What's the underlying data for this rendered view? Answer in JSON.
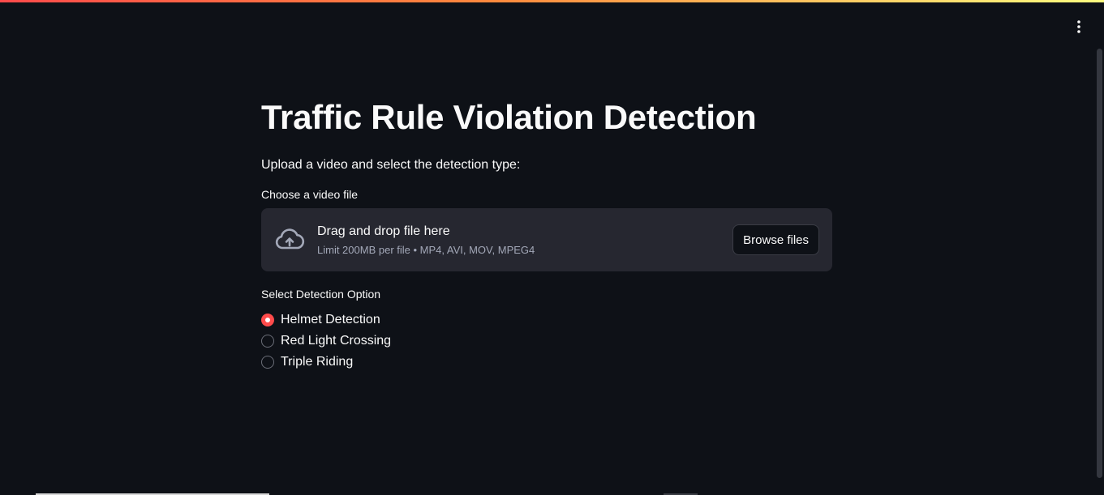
{
  "app": {
    "title": "Traffic Rule Violation Detection",
    "subtitle": "Upload a video and select the detection type:"
  },
  "uploader": {
    "label": "Choose a video file",
    "dropzone_title": "Drag and drop file here",
    "limit_text": "Limit 200MB per file • MP4, AVI, MOV, MPEG4",
    "browse_label": "Browse files",
    "icon": "cloud-upload-icon"
  },
  "detection": {
    "label": "Select Detection Option",
    "options": [
      {
        "label": "Helmet Detection",
        "selected": true
      },
      {
        "label": "Red Light Crossing",
        "selected": false
      },
      {
        "label": "Triple Riding",
        "selected": false
      }
    ]
  },
  "header": {
    "menu_icon": "vertical-ellipsis-icon"
  },
  "colors": {
    "background": "#0e1117",
    "surface": "#262730",
    "accent": "#ff4b4b",
    "text": "#fafafa",
    "muted_text": "#a3a8b8"
  }
}
